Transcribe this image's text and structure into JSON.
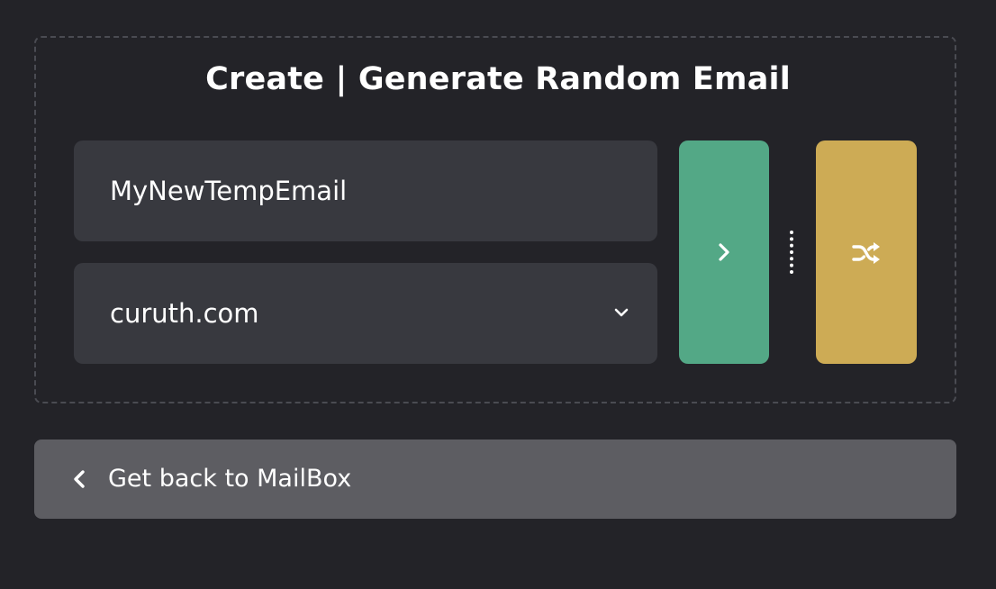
{
  "header": {
    "title": "Create | Generate Random Email"
  },
  "form": {
    "name_value": "MyNewTempEmail",
    "domain_value": "curuth.com"
  },
  "actions": {
    "go_icon": "chevron-right-icon",
    "random_icon": "shuffle-icon"
  },
  "navigation": {
    "back_label": "Get back to MailBox",
    "back_icon": "chevron-left-icon"
  },
  "colors": {
    "background": "#232328",
    "field": "#38393f",
    "go_button": "#53a886",
    "random_button": "#cdab55",
    "back_bar": "#5d5d62"
  }
}
